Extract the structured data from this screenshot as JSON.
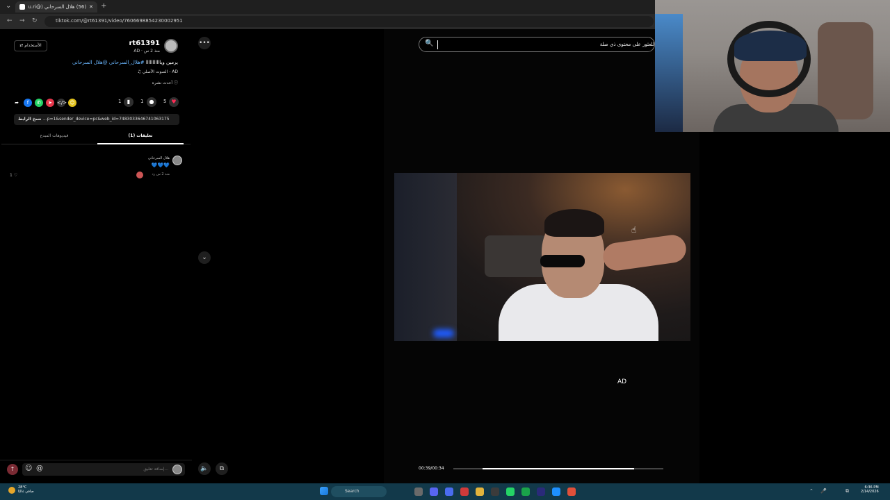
{
  "browser": {
    "tab_title": "(56) هلال السرحاني (@s7u.ri)",
    "new_tab": "+",
    "url": "tiktok.com/@rt61391/video/7606698854230002951"
  },
  "post": {
    "username": "rt61391",
    "meta": "AD · منذ 2 س",
    "switch_label": "الأستخدام",
    "caption_text": "يرمين ويااااااااااا",
    "caption_tags": "#هلال_السرحاني @هلال السرحاني",
    "sound": "الصوت الأصلي - AD",
    "edited": "أعدت نشره",
    "likes": "5",
    "comments_count": "1",
    "saves": "1",
    "copy_link": "نسخ الرابط",
    "link": "p=1&sender_device=pc&web_id=7483033646741063175..."
  },
  "tabs": {
    "comments": "تعليقات (1)",
    "creator": "فيديوهات المبدع"
  },
  "comment": {
    "name": "هلال السرحاني",
    "text": "💙💙💙",
    "meta": "منذ 2 س   رد",
    "like_count": "1 ♡"
  },
  "input": {
    "placeholder": "إضافة تعليق..."
  },
  "search": {
    "placeholder": "للعثور على محتوى ذي صلة"
  },
  "video": {
    "ad_label": "AD",
    "time": "00:39/00:34",
    "progress": 0.86
  },
  "taskbar": {
    "temp": "28°C",
    "weather": "صافي غالبًا",
    "search": "Search",
    "time": "6:36 PM",
    "date": "2/14/2026"
  }
}
